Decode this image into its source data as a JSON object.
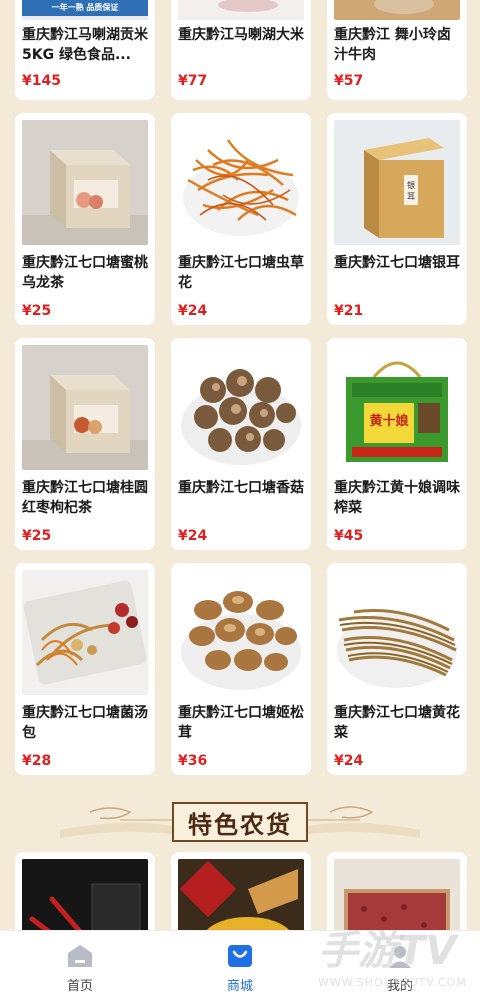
{
  "top_row": [
    {
      "banner_text": "一年一熟  品质保证",
      "title": "重庆黔江马喇湖贡米5KG 绿色食品...",
      "price": "¥145"
    },
    {
      "title": "重庆黔江马喇湖大米",
      "price": "¥77"
    },
    {
      "title": "重庆黔江 舞小玲卤汁牛肉",
      "price": "¥57"
    }
  ],
  "products": [
    {
      "title": "重庆黔江七口塘蜜桃乌龙茶",
      "price": "¥25",
      "image": "tea-box-peach"
    },
    {
      "title": "重庆黔江七口塘虫草花",
      "price": "¥24",
      "image": "cordyceps-flower"
    },
    {
      "title": "重庆黔江七口塘银耳",
      "price": "¥21",
      "image": "tremella-box"
    },
    {
      "title": "重庆黔江七口塘桂圆红枣枸杞茶",
      "price": "¥25",
      "image": "tea-box-longan"
    },
    {
      "title": "重庆黔江七口塘香菇",
      "price": "¥24",
      "image": "shiitake"
    },
    {
      "title": "重庆黔江黄十娘调味榨菜",
      "price": "¥45",
      "image": "pickle-gift-box"
    },
    {
      "title": "重庆黔江七口塘菌汤包",
      "price": "¥28",
      "image": "mushroom-soup-pack"
    },
    {
      "title": "重庆黔江七口塘姬松茸",
      "price": "¥36",
      "image": "agaricus"
    },
    {
      "title": "重庆黔江七口塘黄花菜",
      "price": "¥24",
      "image": "daylily"
    }
  ],
  "section": {
    "title": "特色农货"
  },
  "lower_products": [
    {
      "image": "pepper-product"
    },
    {
      "image": "millet-product"
    },
    {
      "image": "red-bean-product"
    }
  ],
  "tabbar": {
    "tabs": [
      {
        "label": "首页",
        "icon": "home-icon",
        "active": false
      },
      {
        "label": "商城",
        "icon": "shopping-bag-icon",
        "active": true
      },
      {
        "label": "我的",
        "icon": "user-icon",
        "active": false
      }
    ]
  },
  "watermark": {
    "big": "手游TV",
    "small": "WWW.SHOUYOUTV.COM"
  },
  "colors": {
    "price": "#e02020",
    "active_tab": "#1f6fe5",
    "background": "#f4ead8"
  }
}
